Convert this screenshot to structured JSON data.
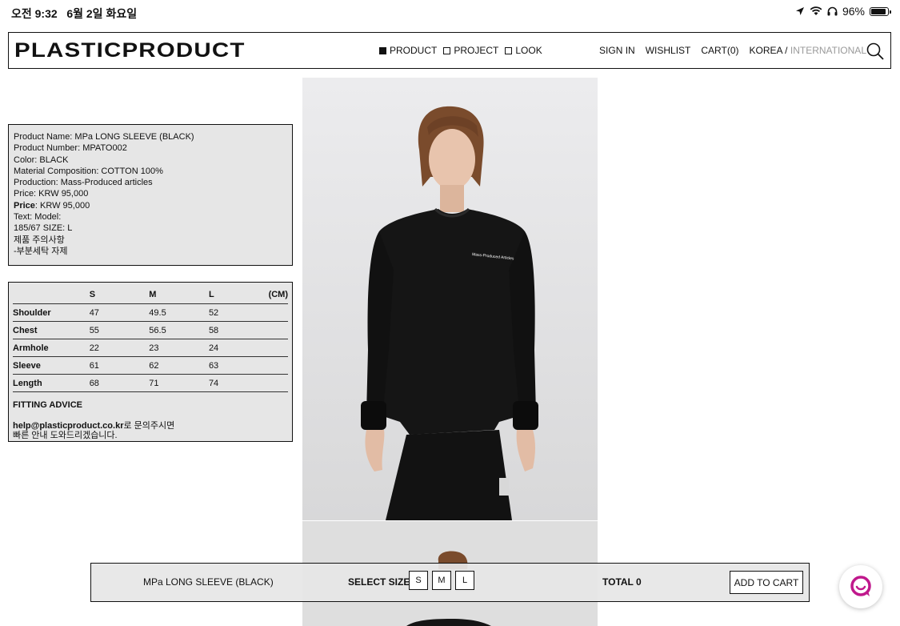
{
  "status_bar": {
    "time": "오전 9:32",
    "date": "6월 2일 화요일",
    "battery_percent": "96%",
    "battery_level": 0.96
  },
  "header": {
    "logo": "PLASTICPRODUCT",
    "nav": [
      {
        "label": "PRODUCT",
        "selected": true
      },
      {
        "label": "PROJECT",
        "selected": false
      },
      {
        "label": "LOOK",
        "selected": false
      }
    ],
    "utils": {
      "sign_in": "SIGN IN",
      "wishlist": "WISHLIST",
      "cart": "CART(0)",
      "region_active": "KOREA /",
      "region_inactive": " INTERNATIONAL"
    }
  },
  "product_info": {
    "lines": [
      "Product Name: MPa LONG SLEEVE (BLACK)",
      "Product Number: MPATO002",
      "Color: BLACK",
      "Material Composition: COTTON 100%",
      "Production: Mass-Produced articles",
      "Price: KRW 95,000"
    ],
    "price_label": "Price",
    "price_value": ": KRW 95,000",
    "lines_after": [
      "Text: Model:",
      "185/67 SIZE: L",
      "제품 주의사항",
      "-부분세탁 자제"
    ]
  },
  "size_table": {
    "headers": [
      "",
      "S",
      "M",
      "L",
      "(CM)"
    ],
    "rows": [
      {
        "label": "Shoulder",
        "values": [
          "47",
          "49.5",
          "52"
        ]
      },
      {
        "label": "Chest",
        "values": [
          "55",
          "56.5",
          "58"
        ]
      },
      {
        "label": "Armhole",
        "values": [
          "22",
          "23",
          "24"
        ]
      },
      {
        "label": "Sleeve",
        "values": [
          "61",
          "62",
          "63"
        ]
      },
      {
        "label": "Length",
        "values": [
          "68",
          "71",
          "74"
        ]
      }
    ],
    "fitting_title": "FITTING ADVICE",
    "email": "help@plasticproduct.co.kr",
    "text_1": "로 문의주시면",
    "text_2": "빠른 안내 도와드리겠습니다."
  },
  "shirt_print": "Mass-Produced Articles",
  "buy_bar": {
    "product_name": "MPa LONG SLEEVE (BLACK)",
    "select_size": "SELECT SIZE",
    "sizes": [
      "S",
      "M",
      "L"
    ],
    "total_label": "TOTAL",
    "total_value": "0",
    "add_to_cart": "ADD TO CART"
  },
  "colors": {
    "border": "#111111",
    "panel": "#e6e6e6",
    "inactive_text": "#9a9a9a",
    "chat_accent": "#c0188c"
  }
}
